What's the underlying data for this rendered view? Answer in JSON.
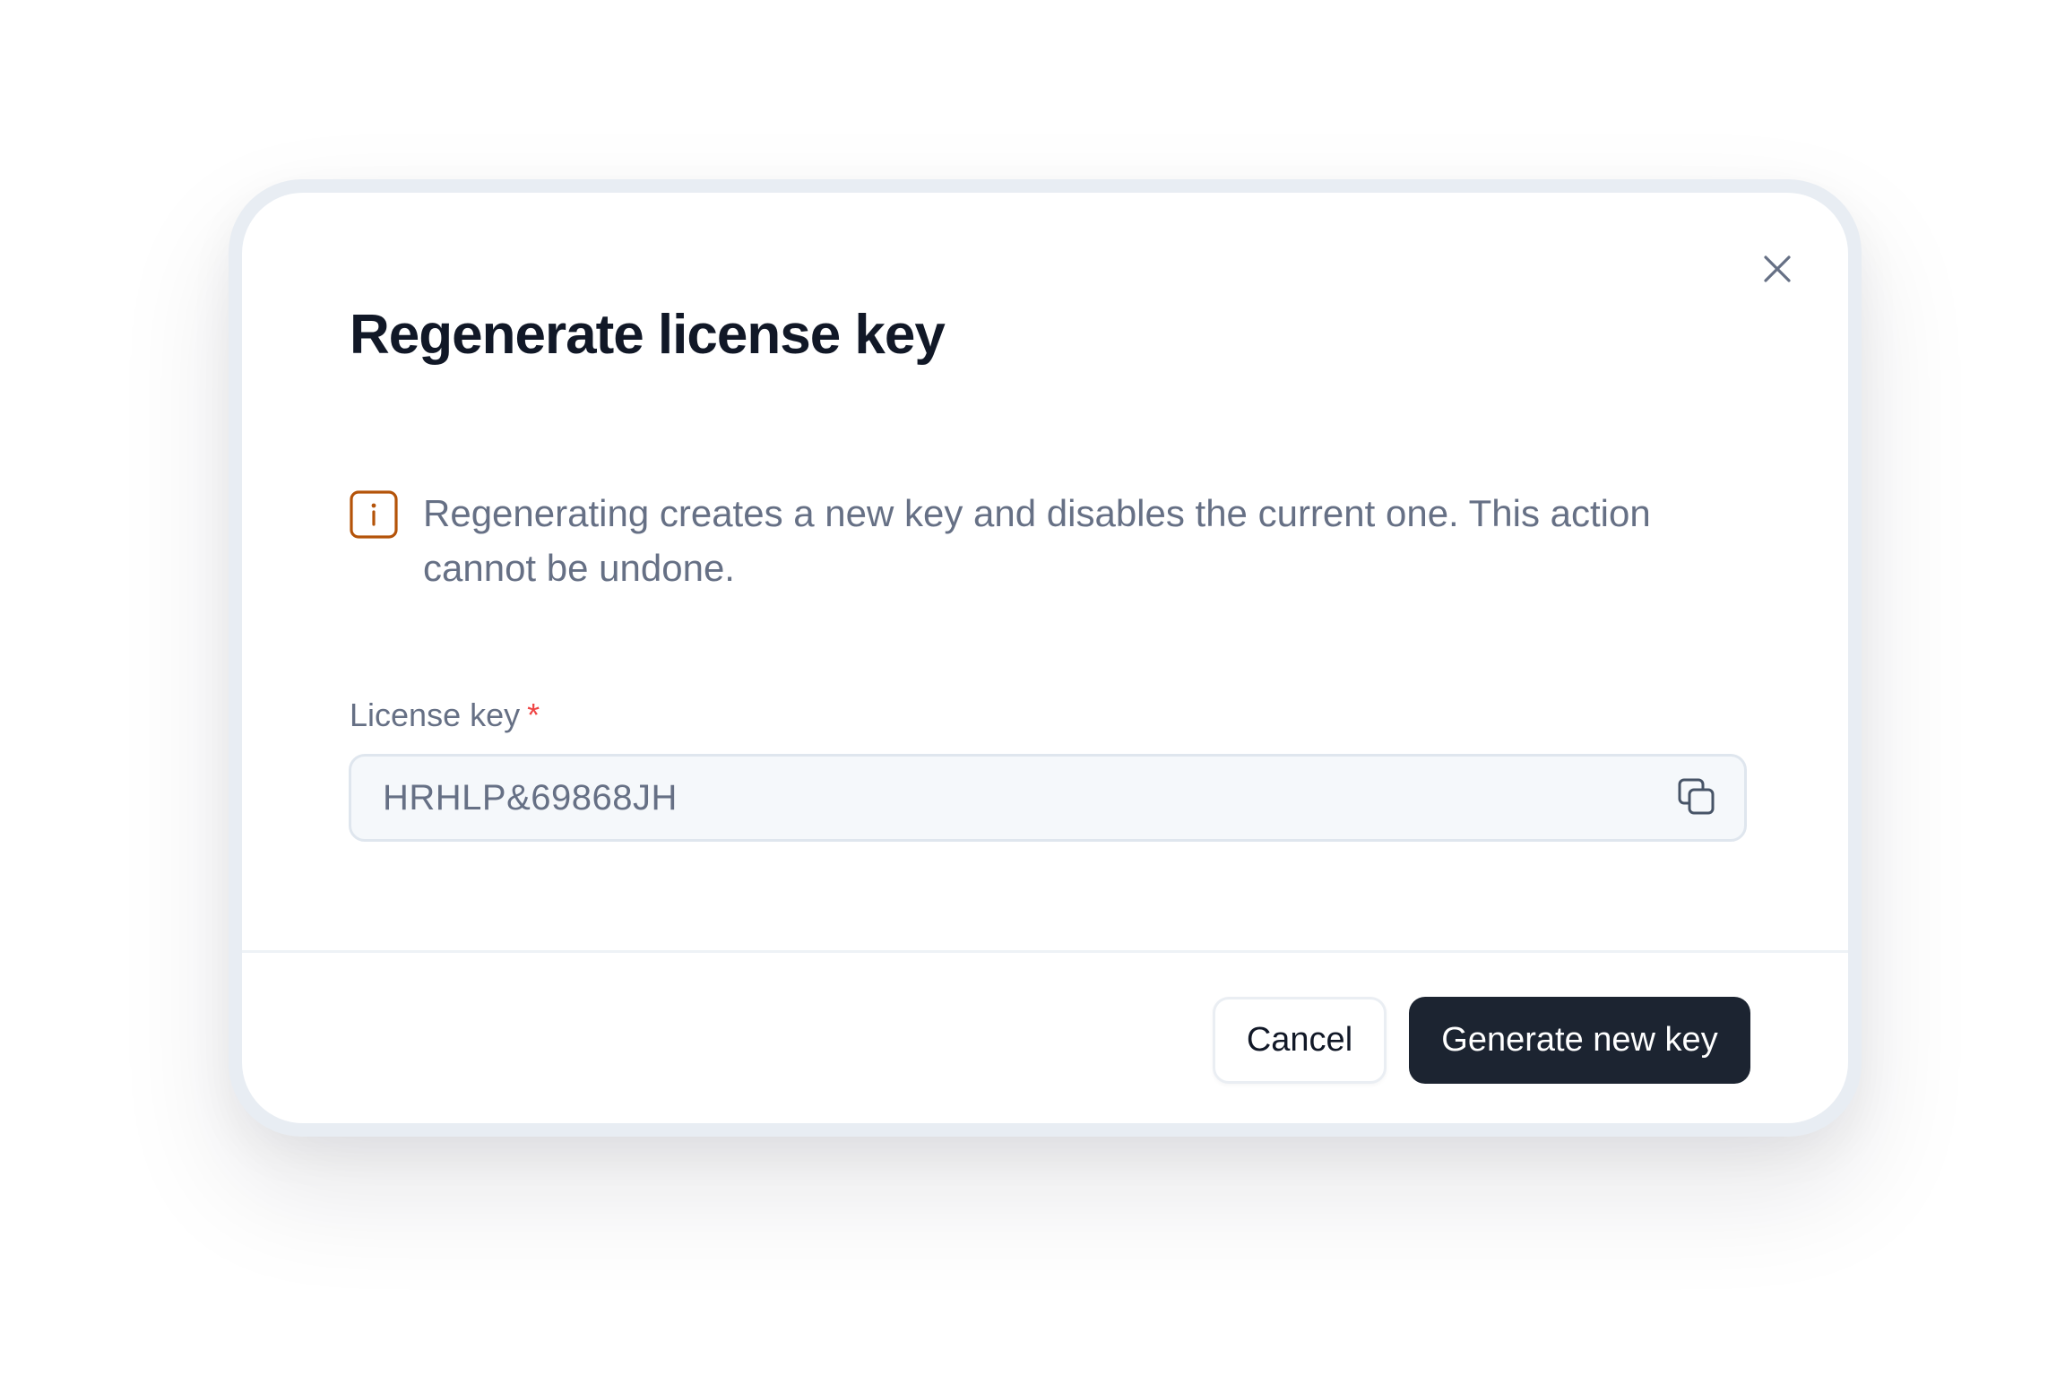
{
  "dialog": {
    "title": "Regenerate license key",
    "close_icon": "close-icon",
    "notice": {
      "icon": "info-icon",
      "icon_color": "#b45309",
      "text": "Regenerating creates a new key and disables the current one. This action cannot be undone."
    },
    "field": {
      "label": "License key",
      "required_marker": "*",
      "value": "HRHLP&69868JH",
      "copy_icon": "copy-icon"
    },
    "footer": {
      "cancel_label": "Cancel",
      "primary_label": "Generate new key"
    }
  },
  "colors": {
    "primary_button": "#1c2431",
    "required": "#ef4444",
    "text_muted": "#667085",
    "heading": "#111827"
  }
}
